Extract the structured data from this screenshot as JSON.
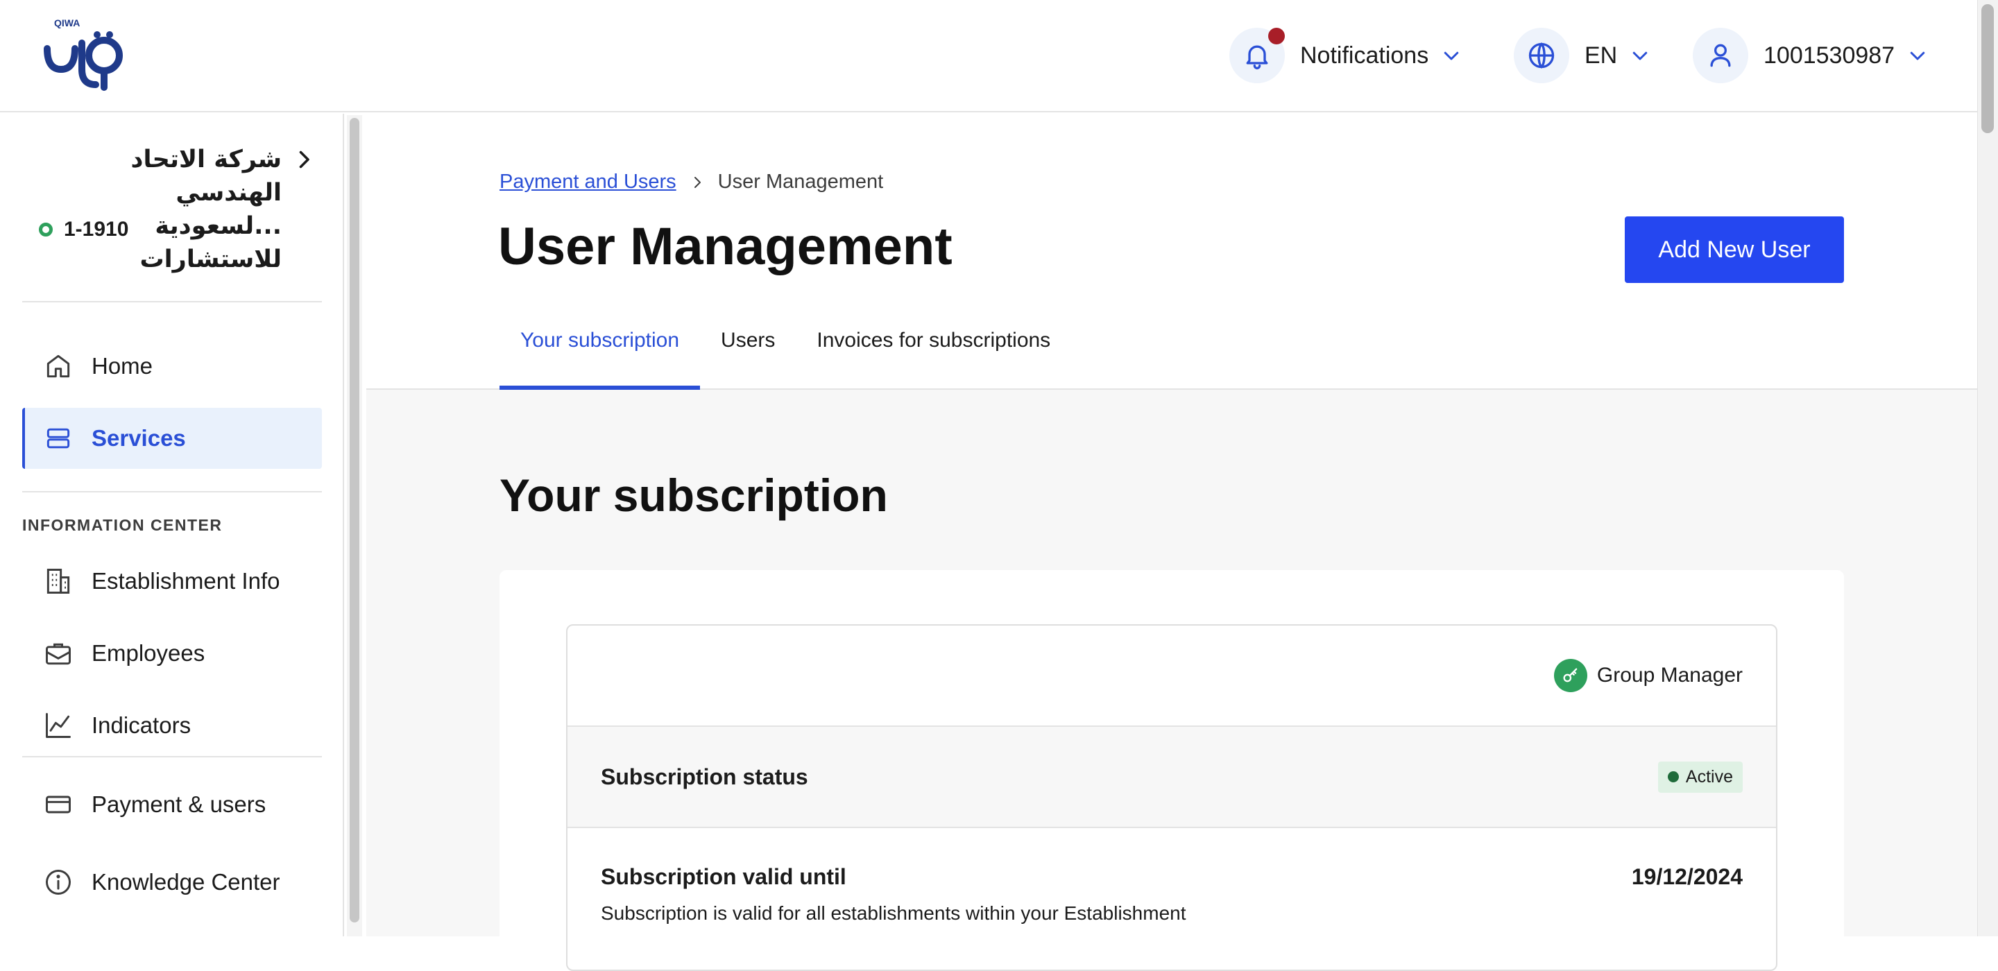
{
  "header": {
    "logo_text": "QIWA",
    "notifications_label": "Notifications",
    "language_label": "EN",
    "user_label": "1001530987"
  },
  "sidebar": {
    "company_name_line1": "شركة الاتحاد الهندسي",
    "company_name_line2": "...لسعودية للاستشارات",
    "company_id": "1-1910",
    "items_top": [
      {
        "label": "Home",
        "icon": "home-icon"
      },
      {
        "label": "Services",
        "icon": "services-icon",
        "active": true
      }
    ],
    "section_title": "INFORMATION CENTER",
    "items_info": [
      {
        "label": "Establishment Info",
        "icon": "building-icon"
      },
      {
        "label": "Employees",
        "icon": "briefcase-icon"
      },
      {
        "label": "Indicators",
        "icon": "chart-icon"
      }
    ],
    "items_bottom": [
      {
        "label": "Payment & users",
        "icon": "card-icon"
      },
      {
        "label": "Knowledge Center",
        "icon": "info-icon"
      }
    ]
  },
  "breadcrumb": {
    "parent": "Payment and Users",
    "current": "User Management"
  },
  "page": {
    "title": "User Management",
    "add_button": "Add New User"
  },
  "tabs": [
    {
      "label": "Your subscription",
      "active": true
    },
    {
      "label": "Users"
    },
    {
      "label": "Invoices for subscriptions"
    }
  ],
  "subscription": {
    "heading": "Your subscription",
    "role": "Group Manager",
    "status_label": "Subscription status",
    "status_value": "Active",
    "valid_label": "Subscription valid until",
    "valid_date": "19/12/2024",
    "valid_description": "Subscription is valid for all establishments within your Establishment"
  },
  "colors": {
    "accent": "#2a4fd6",
    "button": "#2547f0",
    "success": "#2ea05c",
    "notification_dot": "#a81e28"
  }
}
